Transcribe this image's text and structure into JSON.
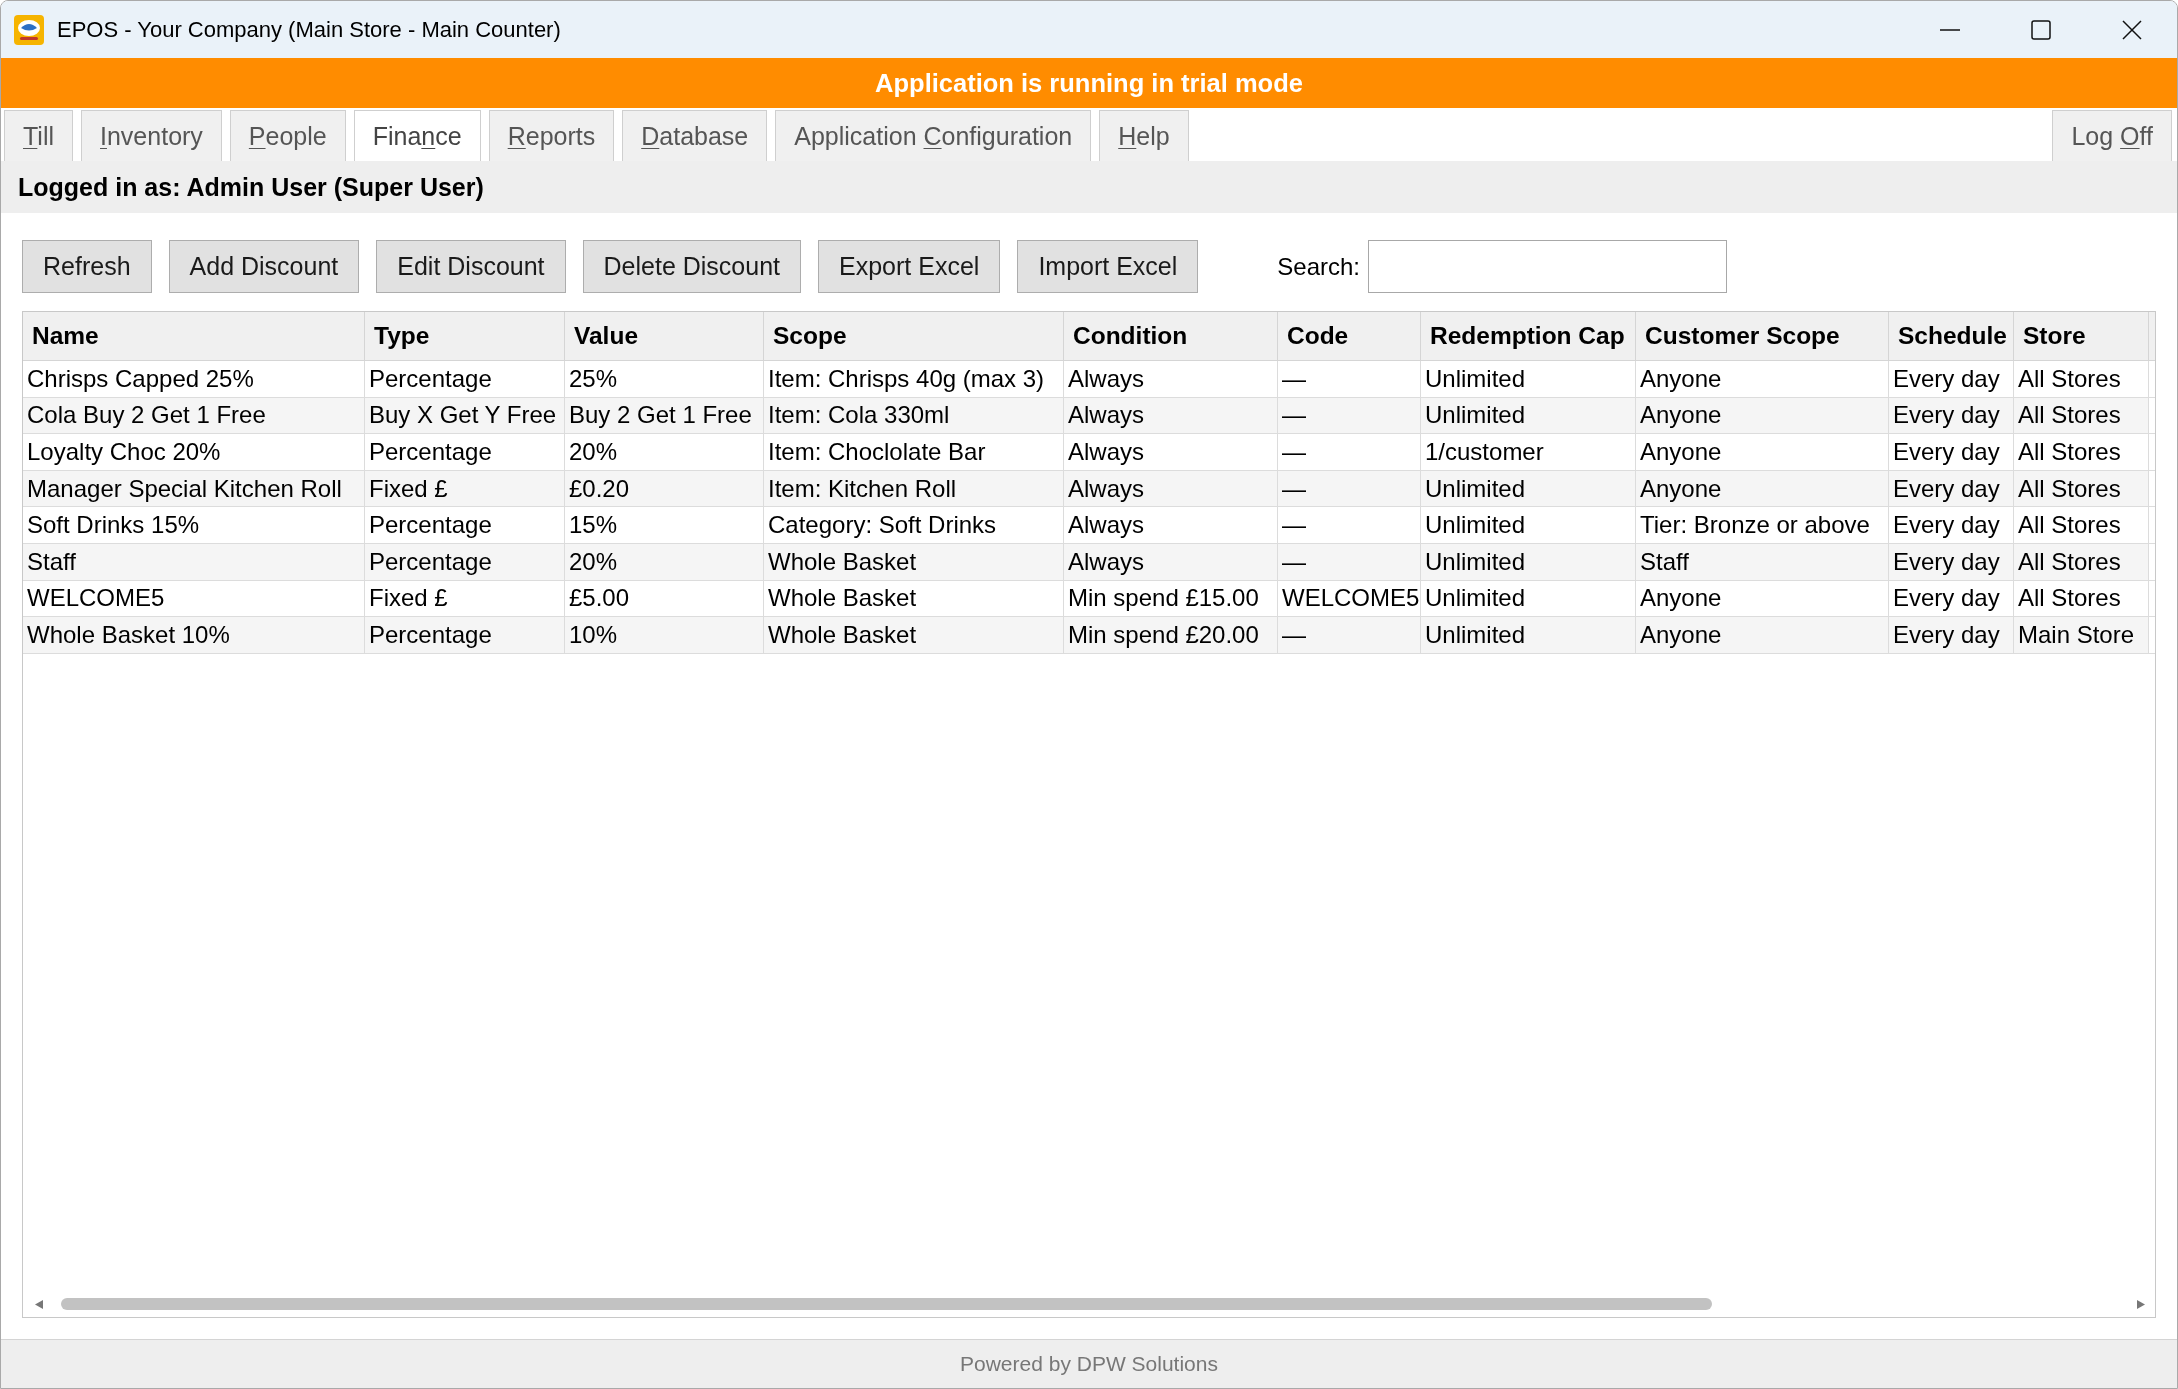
{
  "window": {
    "title": "EPOS - Your Company (Main Store - Main Counter)"
  },
  "trial_banner": "Application is running in trial mode",
  "tabs": [
    {
      "label": {
        "key": "T",
        "after": "ill"
      },
      "selected": false
    },
    {
      "label": {
        "key": "I",
        "after": "nventory"
      },
      "selected": false
    },
    {
      "label": {
        "key": "P",
        "after": "eople"
      },
      "selected": false
    },
    {
      "label": {
        "before": "Fina",
        "key": "n",
        "after": "ce"
      },
      "selected": true
    },
    {
      "label": {
        "key": "R",
        "after": "eports"
      },
      "selected": false
    },
    {
      "label": {
        "key": "D",
        "after": "atabase"
      },
      "selected": false
    },
    {
      "label": {
        "before": "Application ",
        "key": "C",
        "after": "onfiguration"
      },
      "selected": false
    },
    {
      "label": {
        "key": "H",
        "after": "elp"
      },
      "selected": false
    }
  ],
  "log_off_button": {
    "label": {
      "before": "Log ",
      "key": "O",
      "after": "ff"
    }
  },
  "login_status": "Logged in as: Admin User (Super User)",
  "toolbar": {
    "buttons": [
      "Refresh",
      "Add Discount",
      "Edit Discount",
      "Delete Discount",
      "Export Excel",
      "Import Excel"
    ],
    "search": {
      "label": "Search:"
    }
  },
  "table": {
    "columns": [
      "Name",
      "Type",
      "Value",
      "Scope",
      "Condition",
      "Code",
      "Redemption Cap",
      "Customer Scope",
      "Schedule",
      "Store"
    ],
    "rows": [
      [
        "Chrisps Capped 25%",
        "Percentage",
        "25%",
        "Item: Chrisps 40g (max 3)",
        "Always",
        "—",
        "Unlimited",
        "Anyone",
        "Every day",
        "All Stores"
      ],
      [
        "Cola Buy 2 Get 1 Free",
        "Buy X Get Y Free",
        "Buy 2 Get 1 Free",
        "Item: Cola 330ml",
        "Always",
        "—",
        "Unlimited",
        "Anyone",
        "Every day",
        "All Stores"
      ],
      [
        "Loyalty Choc 20%",
        "Percentage",
        "20%",
        "Item: Choclolate Bar",
        "Always",
        "—",
        "1/customer",
        "Anyone",
        "Every day",
        "All Stores"
      ],
      [
        "Manager Special Kitchen Roll",
        "Fixed £",
        "£0.20",
        "Item: Kitchen Roll",
        "Always",
        "—",
        "Unlimited",
        "Anyone",
        "Every day",
        "All Stores"
      ],
      [
        "Soft Drinks 15%",
        "Percentage",
        "15%",
        "Category: Soft Drinks",
        "Always",
        "—",
        "Unlimited",
        "Tier: Bronze or above",
        "Every day",
        "All Stores"
      ],
      [
        "Staff",
        "Percentage",
        "20%",
        "Whole Basket",
        "Always",
        "—",
        "Unlimited",
        "Staff",
        "Every day",
        "All Stores"
      ],
      [
        "WELCOME5",
        "Fixed £",
        "£5.00",
        "Whole Basket",
        "Min spend £15.00",
        "WELCOME5",
        "Unlimited",
        "Anyone",
        "Every day",
        "All Stores"
      ],
      [
        "Whole Basket 10%",
        "Percentage",
        "10%",
        "Whole Basket",
        "Min spend £20.00",
        "—",
        "Unlimited",
        "Anyone",
        "Every day",
        "Main Store"
      ]
    ]
  },
  "footer": "Powered by DPW Solutions"
}
